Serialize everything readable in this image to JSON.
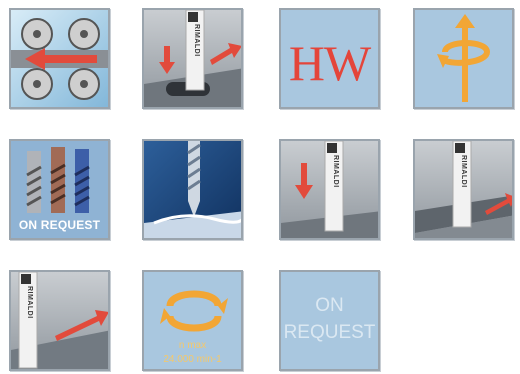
{
  "icons": [
    {
      "name": "belt-drive-feed-icon"
    },
    {
      "name": "plunge-and-slot-milling-icon",
      "tool_label": "RIMALDI"
    },
    {
      "name": "hw-carbide-icon",
      "text": "HW"
    },
    {
      "name": "rotation-axis-icon"
    },
    {
      "name": "coated-cutters-on-request-icon",
      "text": "ON REQUEST"
    },
    {
      "name": "spiral-chip-cutting-icon"
    },
    {
      "name": "plunge-drilling-icon",
      "tool_label": "RIMALDI"
    },
    {
      "name": "edge-profiling-icon",
      "tool_label": "RIMALDI"
    },
    {
      "name": "surface-milling-icon",
      "tool_label": "RIMALDI"
    },
    {
      "name": "max-speed-rotation-icon",
      "line1": "n max",
      "line2": "24.000 min-1"
    },
    {
      "name": "on-request-icon",
      "line1": "ON",
      "line2": "REQUEST"
    }
  ],
  "colors": {
    "tile_blue": "#a9c7df",
    "tile_gray": "#9aa2aa",
    "arrow_red": "#e24b3c",
    "arrow_orange": "#f2a635",
    "text_red": "#e4453a"
  }
}
